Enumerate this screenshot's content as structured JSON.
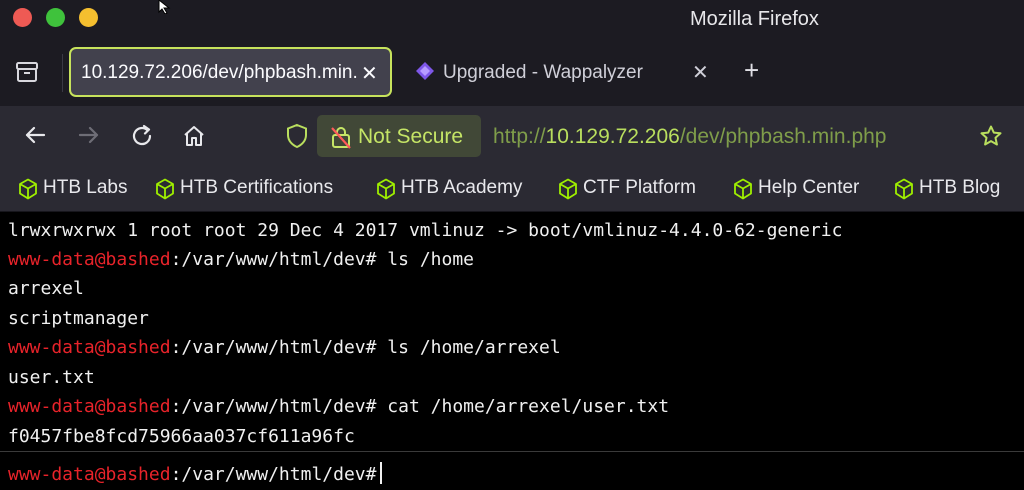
{
  "window": {
    "title": "Mozilla Firefox"
  },
  "tabs": [
    {
      "title": "10.129.72.206/dev/phpbash.min.php",
      "active": true
    },
    {
      "title": "Upgraded - Wappalyzer",
      "active": false
    }
  ],
  "navbar": {
    "security_label": "Not Secure",
    "url_scheme": "http://",
    "url_host": "10.129.72.206",
    "url_path": "/dev/phpbash.min.php"
  },
  "bookmarks": [
    {
      "label": "HTB Labs"
    },
    {
      "label": "HTB Certifications"
    },
    {
      "label": "HTB Academy"
    },
    {
      "label": "CTF Platform"
    },
    {
      "label": "Help Center"
    },
    {
      "label": "HTB Blog"
    }
  ],
  "terminal": {
    "lines": [
      {
        "text": "lrwxrwxrwx 1 root root 29 Dec 4 2017 vmlinuz -> boot/vmlinuz-4.4.0-62-generic"
      },
      {
        "user": "www-data@bashed",
        "path": ":/var/www/html/dev#",
        "cmd": " ls /home"
      },
      {
        "text": "arrexel"
      },
      {
        "text": "scriptmanager"
      },
      {
        "user": "www-data@bashed",
        "path": ":/var/www/html/dev#",
        "cmd": " ls /home/arrexel"
      },
      {
        "text": "user.txt"
      },
      {
        "user": "www-data@bashed",
        "path": ":/var/www/html/dev#",
        "cmd": " cat /home/arrexel/user.txt"
      },
      {
        "text": "f0457fbe8fcd75966aa037cf611a96fc"
      }
    ],
    "input_prompt": {
      "user": "www-data@bashed",
      "path": ":/var/www/html/dev#",
      "value": ""
    }
  },
  "colors": {
    "prompt_user": "#e8232a",
    "url_host": "#b9de5e",
    "security_badge": "#c5e566",
    "active_tab_border": "#c7e35c"
  }
}
